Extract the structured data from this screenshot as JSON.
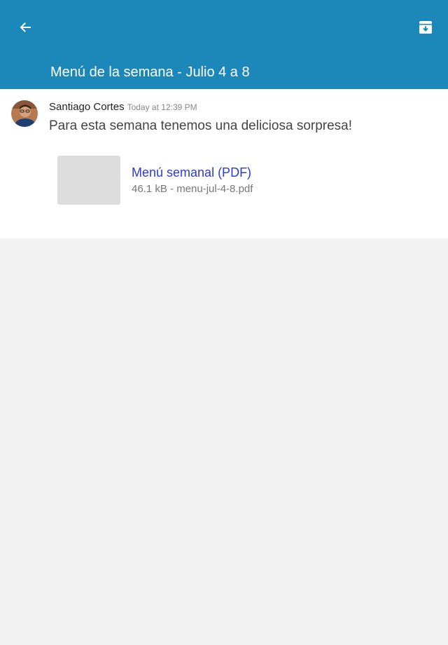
{
  "header": {
    "title": "Menú de la semana - Julio 4 a 8",
    "back_icon": "arrow-left-icon",
    "archive_icon": "archive-icon",
    "bar_color": "#1c88b9"
  },
  "post": {
    "author": "Santiago Cortes",
    "timestamp": "Today at 12:39 PM",
    "message": "Para esta semana tenemos una deliciosa sorpresa!",
    "attachment": {
      "title": "Menú semanal (PDF)",
      "meta": "46.1 kB - menu-jul-4-8.pdf",
      "link_color": "#2a3bd0"
    }
  }
}
